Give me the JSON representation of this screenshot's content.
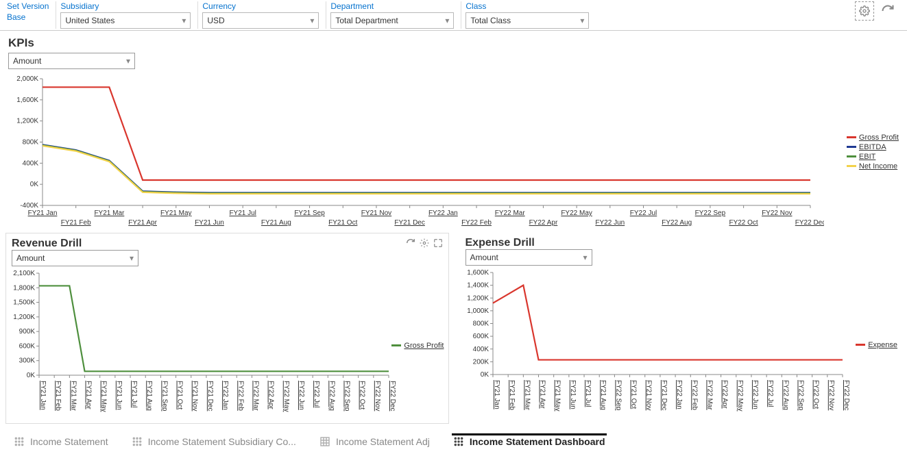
{
  "filters": {
    "version_label": "Set Version",
    "version_value": "Base",
    "subsidiary_label": "Subsidiary",
    "subsidiary_value": "United States",
    "currency_label": "Currency",
    "currency_value": "USD",
    "department_label": "Department",
    "department_value": "Total Department",
    "class_label": "Class",
    "class_value": "Total Class"
  },
  "kpis": {
    "title": "KPIs",
    "view_selector": "Amount",
    "legend": [
      "Gross Profit",
      "EBITDA",
      "EBIT",
      "Net Income"
    ],
    "colors": [
      "#d9362d",
      "#1f3a93",
      "#4e8f3d",
      "#f2d24b"
    ]
  },
  "revenue_drill": {
    "title": "Revenue Drill",
    "view_selector": "Amount",
    "legend": [
      "Gross Profit"
    ],
    "colors": [
      "#4e8f3d"
    ]
  },
  "expense_drill": {
    "title": "Expense Drill",
    "view_selector": "Amount",
    "legend": [
      "Expense"
    ],
    "colors": [
      "#d9362d"
    ]
  },
  "bottom_tabs": [
    {
      "label": "Income Statement",
      "active": false
    },
    {
      "label": "Income Statement Subsidiary Co...",
      "active": false
    },
    {
      "label": "Income Statement Adj",
      "active": false
    },
    {
      "label": "Income Statement Dashboard",
      "active": true
    }
  ],
  "chart_data": [
    {
      "id": "kpis",
      "type": "line",
      "title": "KPIs",
      "xlabel": "",
      "ylabel": "",
      "ylim": [
        -400,
        2000
      ],
      "ytick_step": 400,
      "y_ticks": [
        "-400K",
        "0K",
        "400K",
        "800K",
        "1,200K",
        "1,600K",
        "2,000K"
      ],
      "categories": [
        "FY21 Jan",
        "FY21 Feb",
        "FY21 Mar",
        "FY21 Apr",
        "FY21 May",
        "FY21 Jun",
        "FY21 Jul",
        "FY21 Aug",
        "FY21 Sep",
        "FY21 Oct",
        "FY21 Nov",
        "FY21 Dec",
        "FY22 Jan",
        "FY22 Feb",
        "FY22 Mar",
        "FY22 Apr",
        "FY22 May",
        "FY22 Jun",
        "FY22 Jul",
        "FY22 Aug",
        "FY22 Sep",
        "FY22 Oct",
        "FY22 Nov",
        "FY22 Dec"
      ],
      "series": [
        {
          "name": "Gross Profit",
          "color": "#d9362d",
          "values": [
            1840,
            1840,
            1840,
            80,
            80,
            80,
            80,
            80,
            80,
            80,
            80,
            80,
            80,
            80,
            80,
            80,
            80,
            80,
            80,
            80,
            80,
            80,
            80,
            80
          ]
        },
        {
          "name": "EBITDA",
          "color": "#1f3a93",
          "values": [
            750,
            650,
            450,
            -130,
            -150,
            -160,
            -160,
            -160,
            -160,
            -160,
            -160,
            -160,
            -160,
            -160,
            -160,
            -160,
            -160,
            -160,
            -160,
            -160,
            -160,
            -160,
            -160,
            -160
          ]
        },
        {
          "name": "EBIT",
          "color": "#4e8f3d",
          "values": [
            740,
            640,
            440,
            -140,
            -160,
            -170,
            -170,
            -170,
            -170,
            -170,
            -170,
            -170,
            -170,
            -170,
            -170,
            -170,
            -170,
            -170,
            -170,
            -170,
            -170,
            -170,
            -170,
            -170
          ]
        },
        {
          "name": "Net Income",
          "color": "#f2d24b",
          "values": [
            730,
            630,
            430,
            -150,
            -170,
            -180,
            -180,
            -180,
            -180,
            -180,
            -180,
            -180,
            -180,
            -180,
            -180,
            -180,
            -180,
            -180,
            -180,
            -180,
            -180,
            -180,
            -180,
            -180
          ]
        }
      ]
    },
    {
      "id": "revenue",
      "type": "line",
      "title": "Revenue Drill",
      "xlabel": "",
      "ylabel": "",
      "ylim": [
        0,
        2100
      ],
      "ytick_step": 300,
      "y_ticks": [
        "0K",
        "300K",
        "600K",
        "900K",
        "1,200K",
        "1,500K",
        "1,800K",
        "2,100K"
      ],
      "categories": [
        "FY21 Jan",
        "FY21 Feb",
        "FY21 Mar",
        "FY21 Apr",
        "FY21 May",
        "FY21 Jun",
        "FY21 Jul",
        "FY21 Aug",
        "FY21 Sep",
        "FY21 Oct",
        "FY21 Nov",
        "FY21 Dec",
        "FY22 Jan",
        "FY22 Feb",
        "FY22 Mar",
        "FY22 Apr",
        "FY22 May",
        "FY22 Jun",
        "FY22 Jul",
        "FY22 Aug",
        "FY22 Sep",
        "FY22 Oct",
        "FY22 Nov",
        "FY22 Dec"
      ],
      "series": [
        {
          "name": "Gross Profit",
          "color": "#4e8f3d",
          "values": [
            1840,
            1840,
            1840,
            80,
            80,
            80,
            80,
            80,
            80,
            80,
            80,
            80,
            80,
            80,
            80,
            80,
            80,
            80,
            80,
            80,
            80,
            80,
            80,
            80
          ]
        }
      ]
    },
    {
      "id": "expense",
      "type": "line",
      "title": "Expense Drill",
      "xlabel": "",
      "ylabel": "",
      "ylim": [
        0,
        1600
      ],
      "ytick_step": 200,
      "y_ticks": [
        "0K",
        "200K",
        "400K",
        "600K",
        "800K",
        "1,000K",
        "1,200K",
        "1,400K",
        "1,600K"
      ],
      "categories": [
        "FY21 Jan",
        "FY21 Feb",
        "FY21 Mar",
        "FY21 Apr",
        "FY21 May",
        "FY21 Jun",
        "FY21 Jul",
        "FY21 Aug",
        "FY22 Sep",
        "FY21 Oct",
        "FY21 Nov",
        "FY21 Dec",
        "FY22 Jan",
        "FY22 Feb",
        "FY22 Mar",
        "FY22 Apr",
        "FY22 May",
        "FY22 Jun",
        "FY22 Jul",
        "FY22 Aug",
        "FY22 Sep",
        "FY22 Oct",
        "FY22 Nov",
        "FY22 Dec"
      ],
      "series": [
        {
          "name": "Expense",
          "color": "#d9362d",
          "values": [
            1120,
            1260,
            1400,
            230,
            230,
            230,
            230,
            230,
            230,
            230,
            230,
            230,
            230,
            230,
            230,
            230,
            230,
            230,
            230,
            230,
            230,
            230,
            230,
            230
          ]
        }
      ]
    }
  ]
}
